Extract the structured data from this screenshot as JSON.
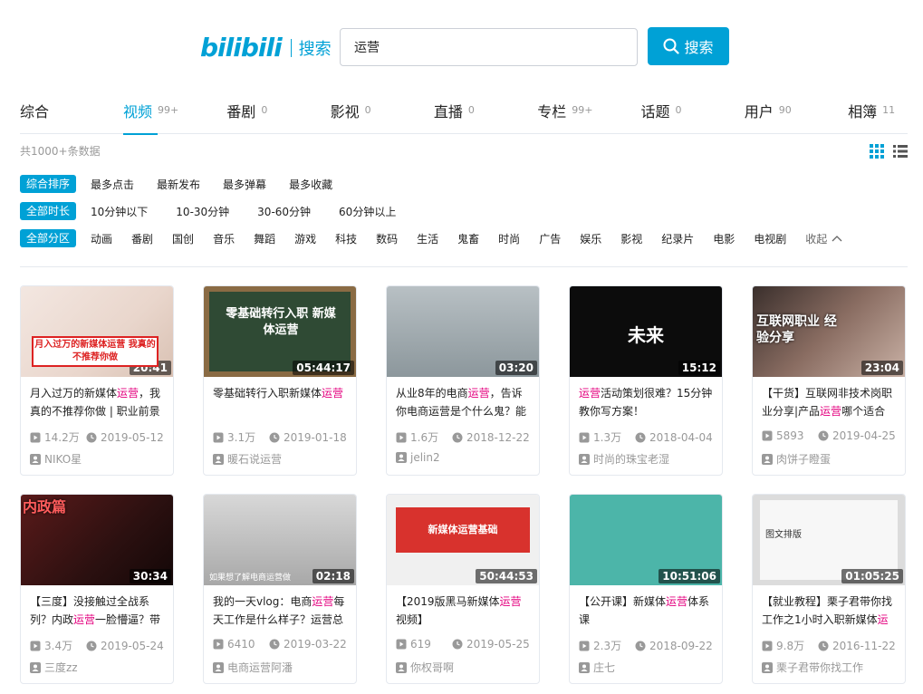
{
  "header": {
    "logo_text": "bilibili",
    "logo_sub": "搜索",
    "search_value": "运营",
    "search_button": "搜索"
  },
  "tabs": [
    {
      "label": "综合",
      "count": ""
    },
    {
      "label": "视频",
      "count": "99+"
    },
    {
      "label": "番剧",
      "count": "0"
    },
    {
      "label": "影视",
      "count": "0"
    },
    {
      "label": "直播",
      "count": "0"
    },
    {
      "label": "专栏",
      "count": "99+"
    },
    {
      "label": "话题",
      "count": "0"
    },
    {
      "label": "用户",
      "count": "90"
    },
    {
      "label": "相簿",
      "count": "11"
    }
  ],
  "total": "共1000+条数据",
  "filters": {
    "order": {
      "tag": "综合排序",
      "options": [
        "最多点击",
        "最新发布",
        "最多弹幕",
        "最多收藏"
      ]
    },
    "duration": {
      "tag": "全部时长",
      "options": [
        "10分钟以下",
        "10-30分钟",
        "30-60分钟",
        "60分钟以上"
      ]
    },
    "category": {
      "tag": "全部分区",
      "options": [
        "动画",
        "番剧",
        "国创",
        "音乐",
        "舞蹈",
        "游戏",
        "科技",
        "数码",
        "生活",
        "鬼畜",
        "时尚",
        "广告",
        "娱乐",
        "影视",
        "纪录片",
        "电影",
        "电视剧"
      ],
      "fold": "收起"
    }
  },
  "videos": [
    {
      "title_pre": "月入过万的新媒体",
      "title_hl": "运营",
      "title_post": "，我真的不推荐你做 | 职业前景",
      "views": "14.2万",
      "date": "2019-05-12",
      "up": "NIKO星",
      "duration": "20:41",
      "thumb_text": "月入过万的新媒体运营 我真的不推荐你做"
    },
    {
      "title_pre": "零基础转行入职新媒体",
      "title_hl": "运营",
      "title_post": "",
      "views": "3.1万",
      "date": "2019-01-18",
      "up": "暖石说运营",
      "duration": "05:44:17",
      "thumb_text": "零基础转行入职 新媒体运营"
    },
    {
      "title_pre": "从业8年的电商",
      "title_hl": "运营",
      "title_post": "，告诉你电商运营是个什么鬼？能",
      "views": "1.6万",
      "date": "2018-12-22",
      "up": "jelin2",
      "duration": "03:20",
      "thumb_text": ""
    },
    {
      "title_pre": "",
      "title_hl": "运营",
      "title_post": "活动策划很难？15分钟教你写方案！",
      "views": "1.3万",
      "date": "2018-04-04",
      "up": "时尚的珠宝老湿",
      "duration": "15:12",
      "thumb_text": "未来"
    },
    {
      "title_pre": "【干货】互联网非技术岗职业分享|产品",
      "title_hl": "运营",
      "title_post": "哪个适合",
      "views": "5893",
      "date": "2019-04-25",
      "up": "肉饼子瞪蛋",
      "duration": "23:04",
      "thumb_text": "互联网职业 经验分享"
    },
    {
      "title_pre": "【三度】没接触过全战系列？内政",
      "title_hl": "运营",
      "title_post": "一脸懵逼？带",
      "views": "3.4万",
      "date": "2019-05-24",
      "up": "三度zz",
      "duration": "30:34",
      "thumb_text": "内政篇"
    },
    {
      "title_pre": "我的一天vlog：电商",
      "title_hl": "运营",
      "title_post": "每天工作是什么样子？运营总",
      "views": "6410",
      "date": "2019-03-22",
      "up": "电商运营阿潘",
      "duration": "02:18",
      "thumb_text": "如果想了解电商运营做"
    },
    {
      "title_pre": "【2019版黑马新媒体",
      "title_hl": "运营",
      "title_post": "视频】",
      "views": "619",
      "date": "2019-05-25",
      "up": "你权哥啊",
      "duration": "50:44:53",
      "thumb_text": "新媒体运营基础"
    },
    {
      "title_pre": "【公开课】新媒体",
      "title_hl": "运营",
      "title_post": "体系课",
      "views": "2.3万",
      "date": "2018-09-22",
      "up": "庄七",
      "duration": "10:51:06",
      "thumb_text": ""
    },
    {
      "title_pre": "【就业教程】栗子君带你找工作之1小时入职新媒体",
      "title_hl": "运营",
      "title_post": "",
      "views": "9.8万",
      "date": "2016-11-22",
      "up": "栗子君带你找工作",
      "duration": "01:05:25",
      "thumb_text": "图文排版"
    }
  ]
}
